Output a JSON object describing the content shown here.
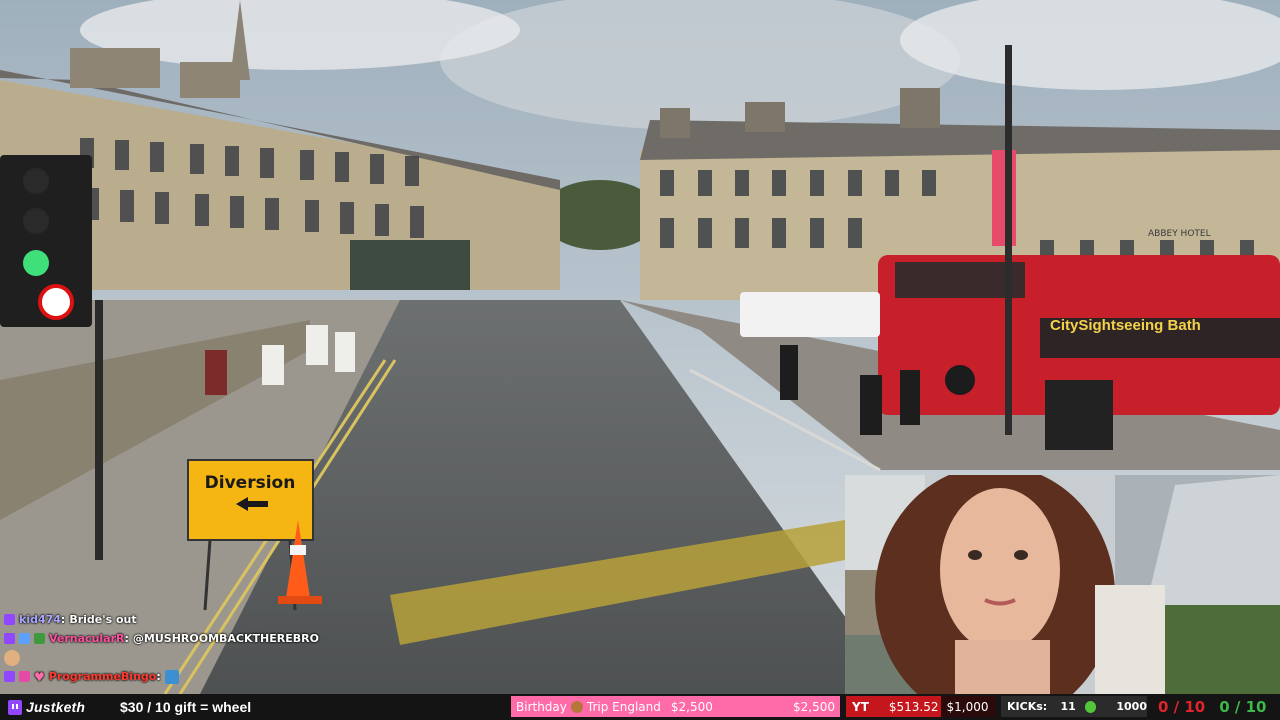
{
  "chat": [
    {
      "user": "kid474",
      "message": "Bride's out",
      "color": "#a8a6ff",
      "badges": [
        "#9146ff"
      ]
    },
    {
      "user": "VernacularR",
      "message": "@MUSHROOMBACKTHEREBRO",
      "color": "#ff4fa0",
      "badges": [
        "#9146ff",
        "#5aa0ff",
        "#3d9b3d"
      ]
    },
    {
      "user": "",
      "message": "",
      "color": "#ffffff",
      "badges": [
        "#e0b080"
      ]
    },
    {
      "user": "ProgrammeBingo",
      "message": "",
      "color": "#ff3b30",
      "badges": [
        "#9146ff",
        "#e64aa8",
        "#3d8fd4"
      ]
    }
  ],
  "scene": {
    "diversion_sign": "Diversion",
    "hotel_sign": "ABBEY HOTEL",
    "bus_text": "CitySightseeing Bath"
  },
  "bottom_bar": {
    "brand": "Justketh",
    "gift_text": "$30 / 10 gift = wheel",
    "goal_label": "Birthday",
    "goal_name": "Trip England",
    "goal_current": "$2,500",
    "goal_target": "$2,500",
    "yt_label": "YT",
    "yt_amount": "$513.52",
    "yt_goal": "$1,000",
    "kicks_label": "KICKs:",
    "kicks_count": "11",
    "kicks_goal": "1000",
    "score_red": "0 / 10",
    "score_green": "0 / 10"
  },
  "colors": {
    "goal_bg": "#ff6aa8",
    "yt_red": "#c4161c",
    "score_red": "#e0242b",
    "score_green": "#3fb84a"
  }
}
